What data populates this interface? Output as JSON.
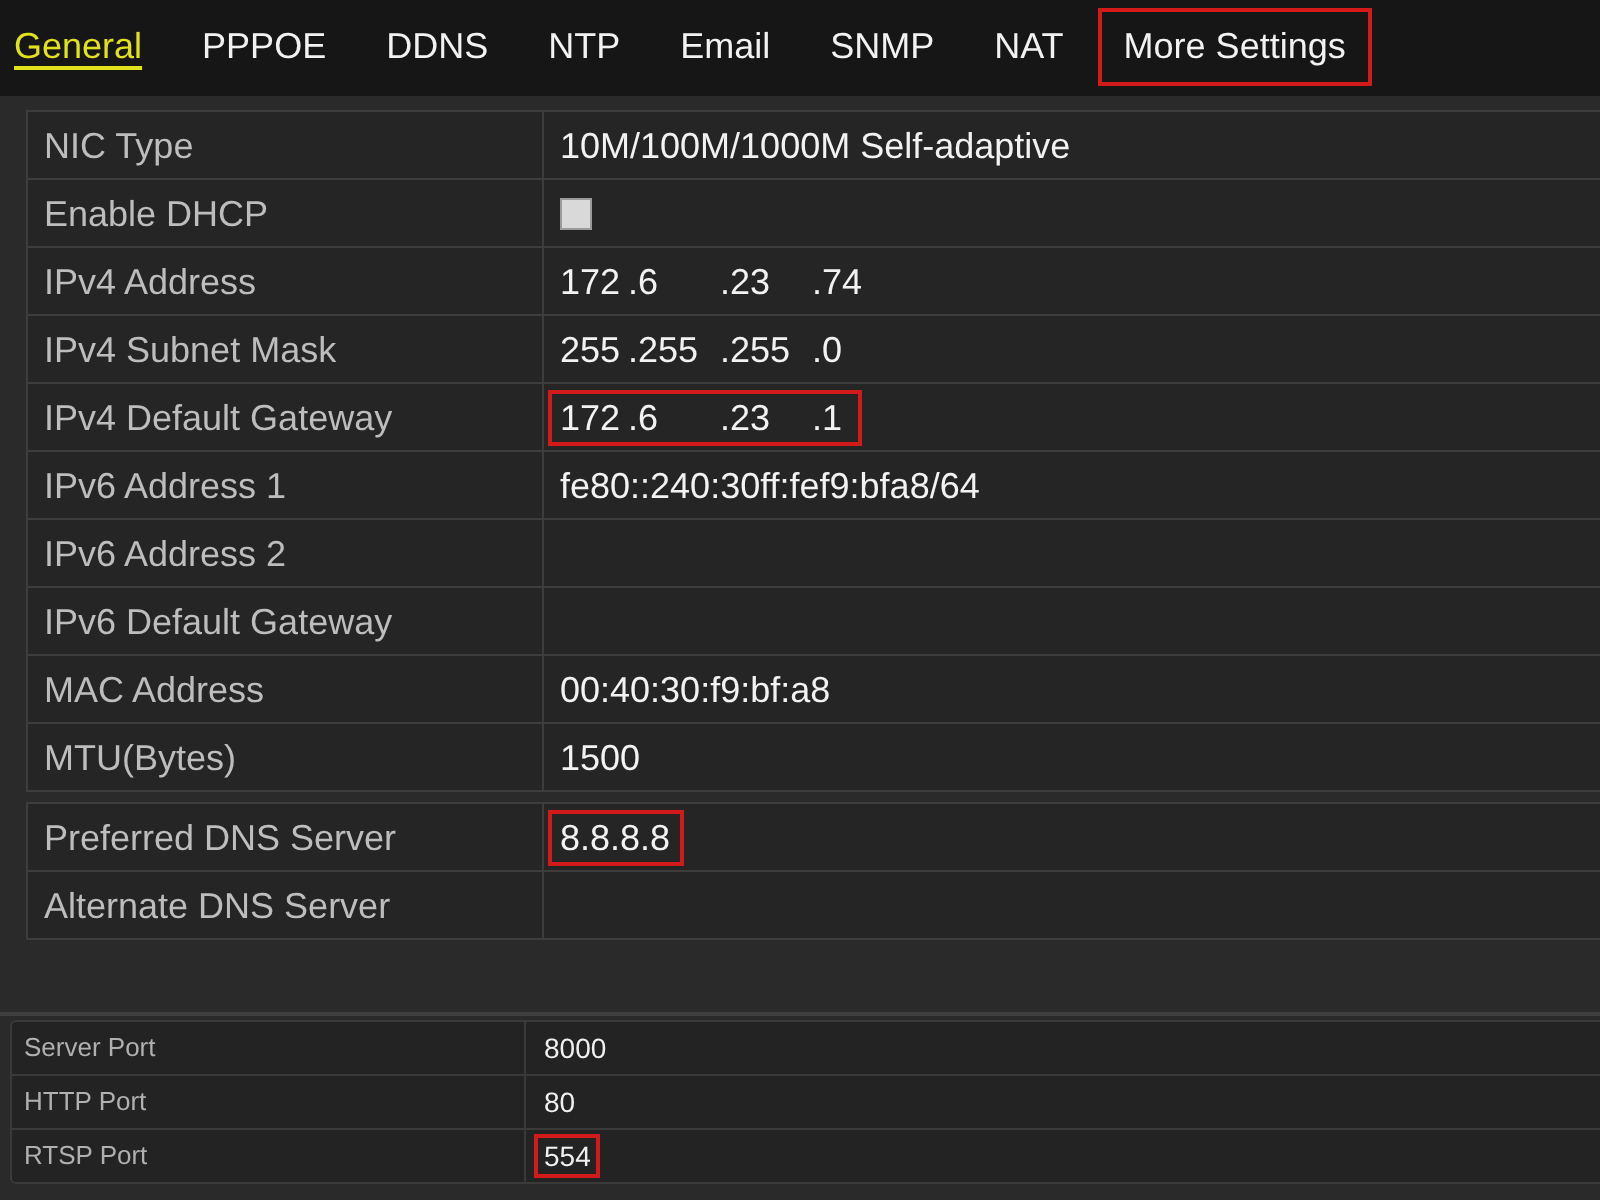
{
  "tabs": [
    {
      "label": "General",
      "selected": true,
      "highlighted": false
    },
    {
      "label": "PPPOE",
      "selected": false,
      "highlighted": false
    },
    {
      "label": "DDNS",
      "selected": false,
      "highlighted": false
    },
    {
      "label": "NTP",
      "selected": false,
      "highlighted": false
    },
    {
      "label": "Email",
      "selected": false,
      "highlighted": false
    },
    {
      "label": "SNMP",
      "selected": false,
      "highlighted": false
    },
    {
      "label": "NAT",
      "selected": false,
      "highlighted": false
    },
    {
      "label": "More Settings",
      "selected": false,
      "highlighted": true
    }
  ],
  "settings_groups": [
    {
      "rows": [
        {
          "kind": "text",
          "label": "NIC Type",
          "value": "10M/100M/1000M Self-adaptive",
          "highlighted": false
        },
        {
          "kind": "checkbox",
          "label": "Enable DHCP",
          "checked": false,
          "highlighted": false
        },
        {
          "kind": "ip",
          "label": "IPv4 Address",
          "octets": [
            "172",
            ".6",
            ".23",
            ".74"
          ],
          "highlighted": false
        },
        {
          "kind": "ip",
          "label": "IPv4 Subnet Mask",
          "octets": [
            "255",
            ".255",
            ".255",
            ".0"
          ],
          "highlighted": false
        },
        {
          "kind": "ip",
          "label": "IPv4 Default Gateway",
          "octets": [
            "172",
            ".6",
            ".23",
            ".1"
          ],
          "highlighted": true
        },
        {
          "kind": "text",
          "label": "IPv6 Address 1",
          "value": "fe80::240:30ff:fef9:bfa8/64",
          "highlighted": false
        },
        {
          "kind": "empty",
          "label": "IPv6 Address 2",
          "highlighted": false
        },
        {
          "kind": "empty",
          "label": "IPv6 Default Gateway",
          "highlighted": false
        },
        {
          "kind": "text",
          "label": "MAC Address",
          "value": "00:40:30:f9:bf:a8",
          "highlighted": false
        },
        {
          "kind": "text",
          "label": "MTU(Bytes)",
          "value": "1500",
          "highlighted": false
        }
      ]
    },
    {
      "rows": [
        {
          "kind": "text",
          "label": "Preferred DNS Server",
          "value": "8.8.8.8",
          "highlighted": true
        },
        {
          "kind": "empty",
          "label": "Alternate DNS Server",
          "highlighted": false
        }
      ]
    }
  ],
  "ports": {
    "rows": [
      {
        "label": "Server Port",
        "value": "8000",
        "highlighted": false
      },
      {
        "label": "HTTP Port",
        "value": "80",
        "highlighted": false
      },
      {
        "label": "RTSP Port",
        "value": "554",
        "highlighted": true
      }
    ]
  }
}
